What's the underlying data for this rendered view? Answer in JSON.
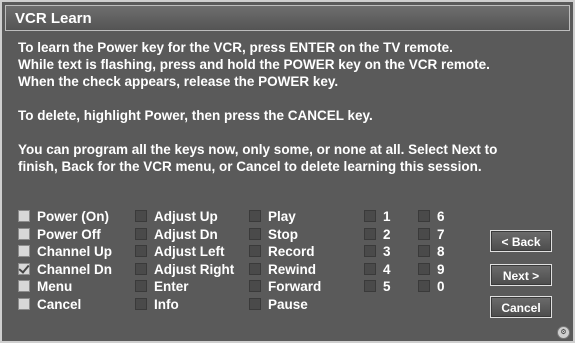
{
  "window": {
    "title": "VCR Learn"
  },
  "instructions": [
    "To learn the Power key for the VCR, press ENTER on the TV remote.",
    "While text is flashing, press and hold the POWER key on the VCR remote.",
    "When the check appears, release the POWER key.",
    "To delete, highlight Power, then press the CANCEL key.",
    "You can program all the keys now, only some, or none at all. Select Next to",
    "finish, Back for the VCR menu, or Cancel to delete learning this session."
  ],
  "keys": {
    "col1": [
      {
        "label": "Power (On)",
        "state": "active"
      },
      {
        "label": "Power Off",
        "state": "active"
      },
      {
        "label": "Channel Up",
        "state": "active"
      },
      {
        "label": "Channel Dn",
        "state": "checked"
      },
      {
        "label": "Menu",
        "state": "active"
      },
      {
        "label": "Cancel",
        "state": "active"
      }
    ],
    "col2": [
      {
        "label": "Adjust Up",
        "state": "dim"
      },
      {
        "label": "Adjust Dn",
        "state": "dim"
      },
      {
        "label": "Adjust Left",
        "state": "dim"
      },
      {
        "label": "Adjust Right",
        "state": "dim"
      },
      {
        "label": "Enter",
        "state": "dim"
      },
      {
        "label": "Info",
        "state": "dim"
      }
    ],
    "col3": [
      {
        "label": "Play",
        "state": "dim"
      },
      {
        "label": "Stop",
        "state": "dim"
      },
      {
        "label": "Record",
        "state": "dim"
      },
      {
        "label": "Rewind",
        "state": "dim"
      },
      {
        "label": "Forward",
        "state": "dim"
      },
      {
        "label": "Pause",
        "state": "dim"
      }
    ],
    "col4": [
      {
        "label": "1",
        "state": "dim"
      },
      {
        "label": "2",
        "state": "dim"
      },
      {
        "label": "3",
        "state": "dim"
      },
      {
        "label": "4",
        "state": "dim"
      },
      {
        "label": "5",
        "state": "dim"
      }
    ],
    "col5": [
      {
        "label": "6",
        "state": "dim"
      },
      {
        "label": "7",
        "state": "dim"
      },
      {
        "label": "8",
        "state": "dim"
      },
      {
        "label": "9",
        "state": "dim"
      },
      {
        "label": "0",
        "state": "dim"
      }
    ]
  },
  "buttons": {
    "back": "< Back",
    "next": "Next >",
    "cancel": "Cancel"
  },
  "corner_icon": "settings-badge-icon"
}
